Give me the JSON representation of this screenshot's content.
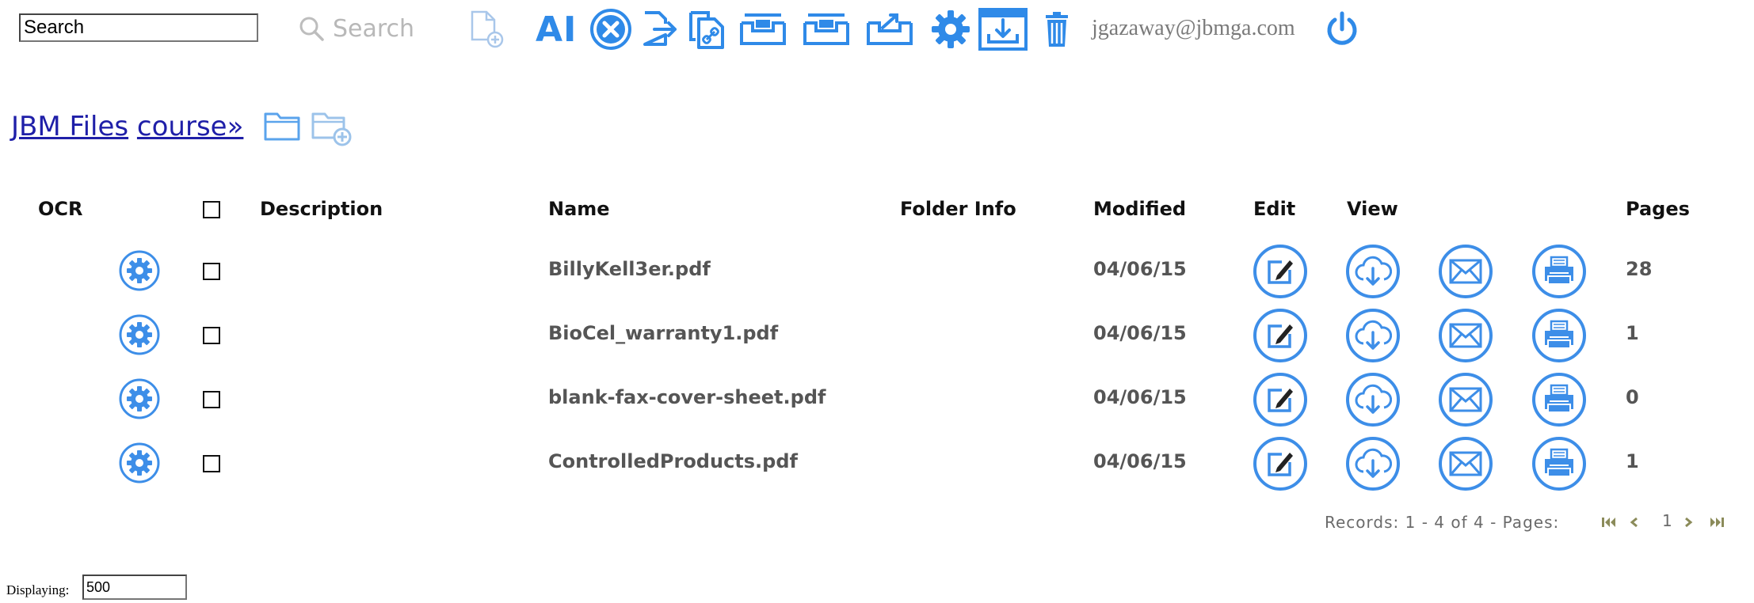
{
  "toolbar": {
    "search_value": "Search",
    "search_button_label": "Search",
    "ai_label": "AI",
    "user_email": "jgazaway@jbmga.com"
  },
  "icons": {
    "search_button": "magnifier-icon",
    "new_document": "add-document-icon",
    "ai": "ai-icon",
    "cancel": "close-circle-icon",
    "export": "export-document-icon",
    "link": "link-documents-icon",
    "inbox_in_1": "inbox-tray-icon",
    "inbox_in_2": "inbox-tray-icon",
    "inbox_out": "outbox-tray-icon",
    "settings": "gear-icon",
    "download": "download-tray-icon",
    "delete": "trash-icon",
    "logout": "power-icon",
    "folder": "folder-icon",
    "add_folder": "add-folder-icon",
    "ocr": "gear-icon",
    "edit": "edit-icon",
    "view": "cloud-download-icon",
    "email": "envelope-icon",
    "print": "printer-icon"
  },
  "colors": {
    "accent": "#3d8ee8",
    "link": "#1f1fa8",
    "muted": "#6a6a6a"
  },
  "breadcrumb": {
    "root": "JBM Files",
    "current": "course»"
  },
  "table": {
    "headers": {
      "ocr": "OCR",
      "description": "Description",
      "name": "Name",
      "folder_info": "Folder Info",
      "modified": "Modified",
      "edit": "Edit",
      "view": "View",
      "pages": "Pages"
    },
    "rows": [
      {
        "description": "",
        "name": "BillyKell3er.pdf",
        "folder_info": "",
        "modified": "04/06/15",
        "pages": "28"
      },
      {
        "description": "",
        "name": "BioCel_warranty1.pdf",
        "folder_info": "",
        "modified": "04/06/15",
        "pages": "1"
      },
      {
        "description": "",
        "name": "blank-fax-cover-sheet.pdf",
        "folder_info": "",
        "modified": "04/06/15",
        "pages": "0"
      },
      {
        "description": "",
        "name": "ControlledProducts.pdf",
        "folder_info": "",
        "modified": "04/06/15",
        "pages": "1"
      }
    ]
  },
  "pager": {
    "summary": "Records: 1 - 4 of 4 - Pages:",
    "current_page": "1"
  },
  "footer": {
    "displaying_label": "Displaying:",
    "displaying_value": "500"
  }
}
